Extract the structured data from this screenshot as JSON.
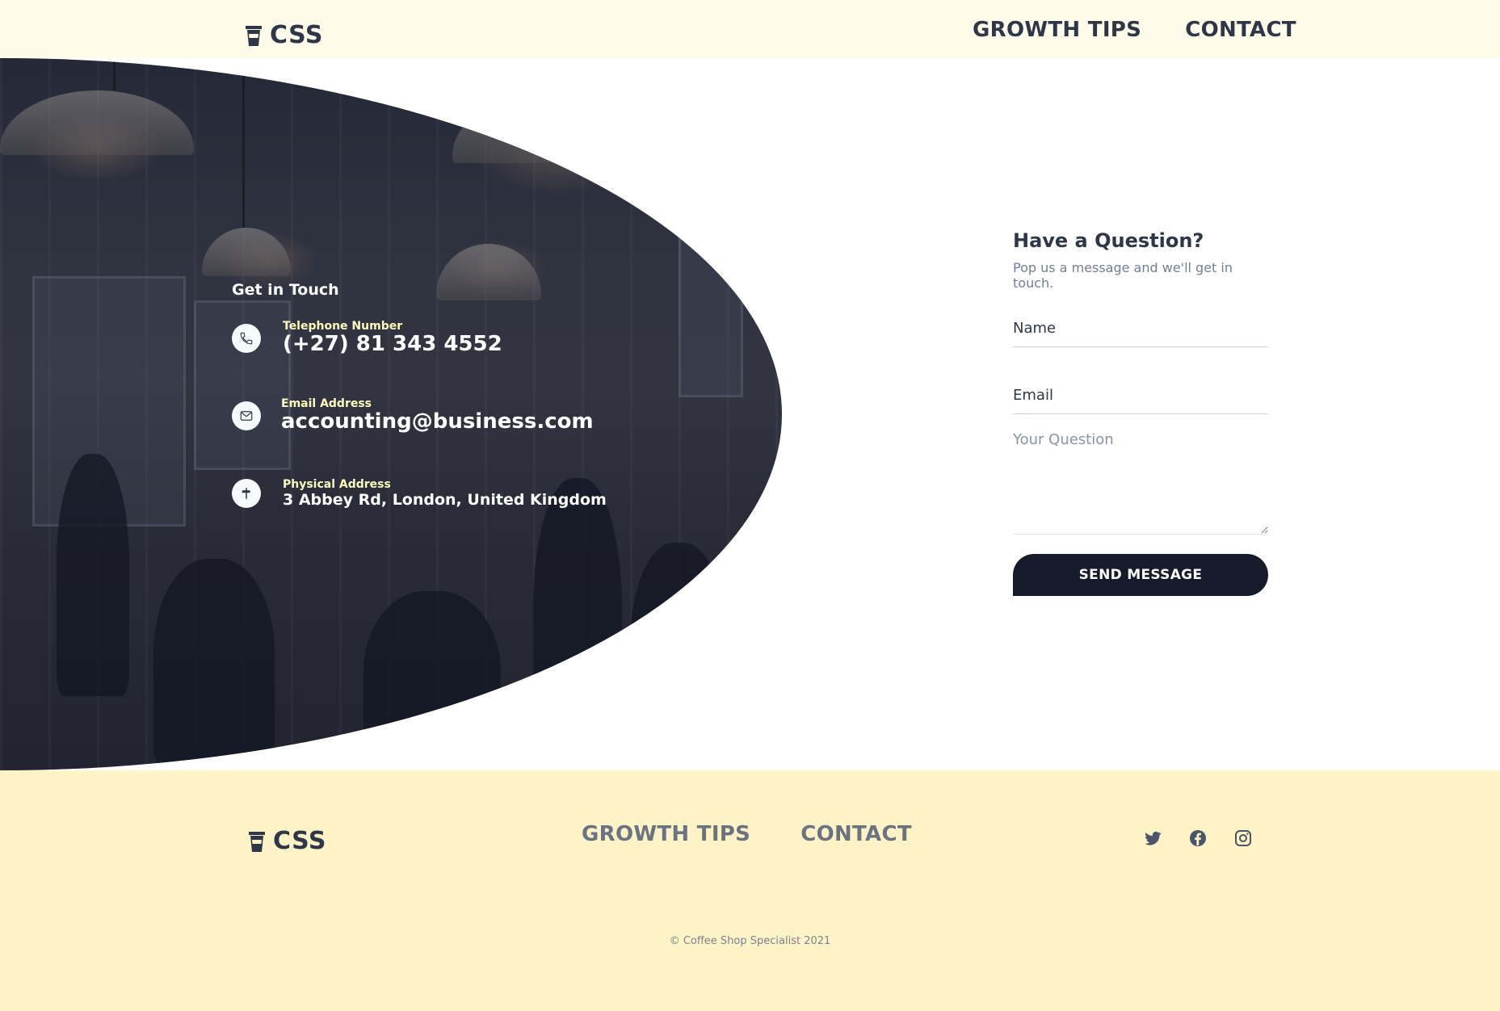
{
  "brand": {
    "name": "CSS"
  },
  "nav": {
    "growth_tips": "GROWTH TIPS",
    "contact": "CONTACT"
  },
  "contact": {
    "heading": "Get in Touch",
    "phone": {
      "label": "Telephone Number",
      "value": "(+27) 81 343 4552",
      "icon": "phone-icon"
    },
    "email": {
      "label": "Email Address",
      "value": "accounting@business.com",
      "icon": "mail-icon"
    },
    "address": {
      "label": "Physical Address",
      "value": "3 Abbey Rd, London, United Kingdom",
      "icon": "signpost-icon"
    }
  },
  "form": {
    "title": "Have a Question?",
    "subtitle": "Pop us a message and we'll get in touch.",
    "name_placeholder": "Name",
    "email_placeholder": "Email",
    "question_placeholder": "Your Question",
    "submit_label": "SEND MESSAGE"
  },
  "footer": {
    "social": [
      "twitter-icon",
      "facebook-icon",
      "instagram-icon"
    ],
    "copyright": "© Coffee Shop Specialist 2021"
  },
  "colors": {
    "header_bg": "#fffbeb",
    "footer_bg": "#fef3c7",
    "button_bg": "#151b2a",
    "text": "#2d3748"
  }
}
